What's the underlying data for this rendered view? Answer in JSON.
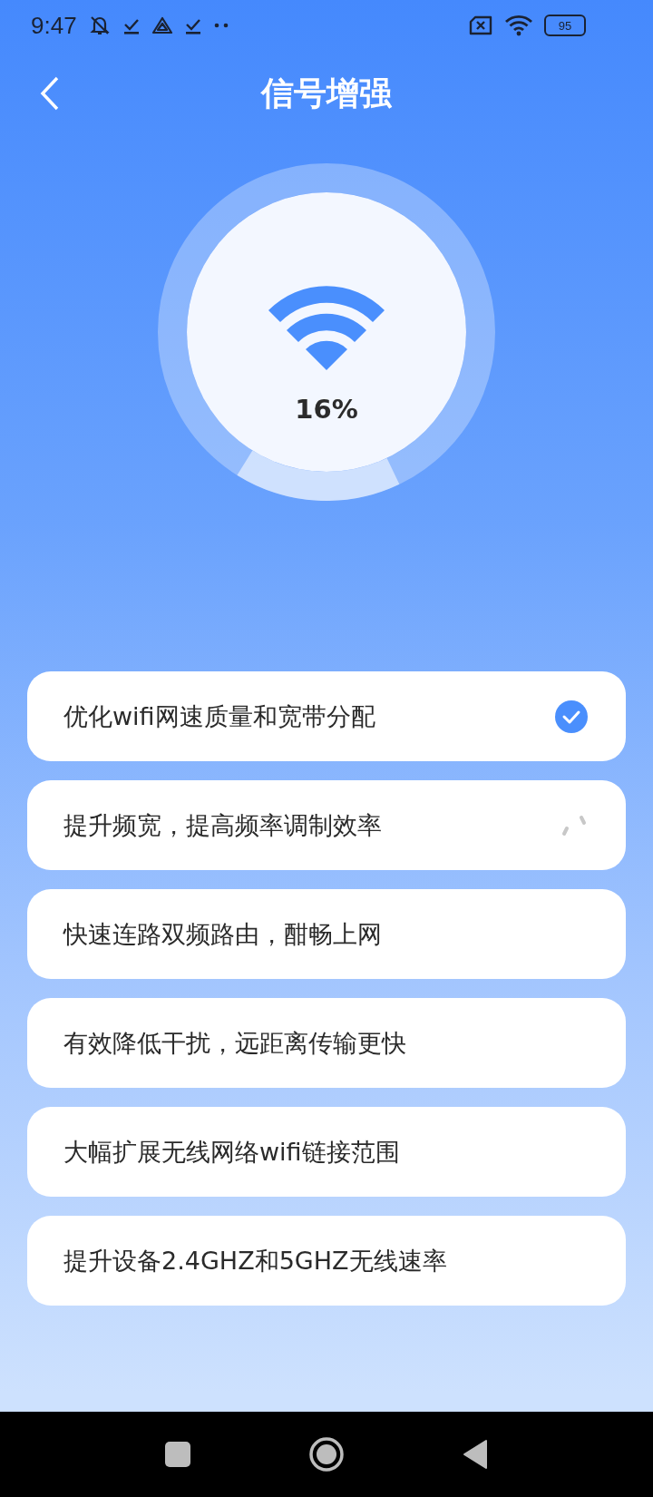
{
  "status_bar": {
    "time": "9:47",
    "battery": "95"
  },
  "header": {
    "title": "信号增强"
  },
  "meter": {
    "reading": "16%"
  },
  "tasks": [
    {
      "label": "优化wifi网速质量和宽带分配",
      "kind": "done"
    },
    {
      "label": "提升频宽，提高频率调制效率",
      "kind": "loading"
    },
    {
      "label": "快速连路双频路由，酣畅上网",
      "kind": "pending"
    },
    {
      "label": "有效降低干扰，远距离传输更快",
      "kind": "pending"
    },
    {
      "label": "大幅扩展无线网络wifi链接范围",
      "kind": "pending"
    },
    {
      "label": "提升设备2.4GHZ和5GHZ无线速率",
      "kind": "pending"
    }
  ]
}
